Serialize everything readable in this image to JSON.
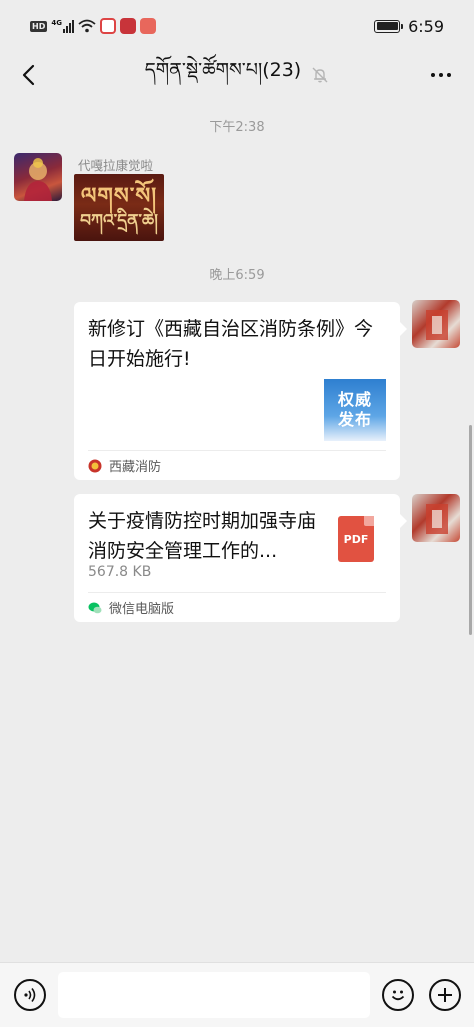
{
  "status_bar": {
    "network_badge": "HD",
    "signal_label": "4G",
    "time": "6:59"
  },
  "header": {
    "title": "དགོན་སྡེ་ཚོགས་པ།(23)",
    "mute": "muted-icon"
  },
  "messages": {
    "time_1": "下午2:38",
    "sender_name": "代嘎拉康觉啦",
    "sticker_line_1": "ལགས་སོ།",
    "sticker_line_2": "བཀའ་དྲིན་ཆེ།",
    "time_2": "晚上6:59",
    "article": {
      "title": "新修订《西藏自治区消防条例》今日开始施行!",
      "thumb_line_1": "权威",
      "thumb_line_2": "发布",
      "source": "西藏消防"
    },
    "file": {
      "title": "关于疫情防控时期加强寺庙消防安全管理工作的...",
      "size": "567.8 KB",
      "type_label": "PDF",
      "source": "微信电脑版"
    }
  },
  "colors": {
    "background": "#ededed",
    "bubble": "#ffffff",
    "pdf_red": "#e15241",
    "wechat_green": "#07c160"
  }
}
